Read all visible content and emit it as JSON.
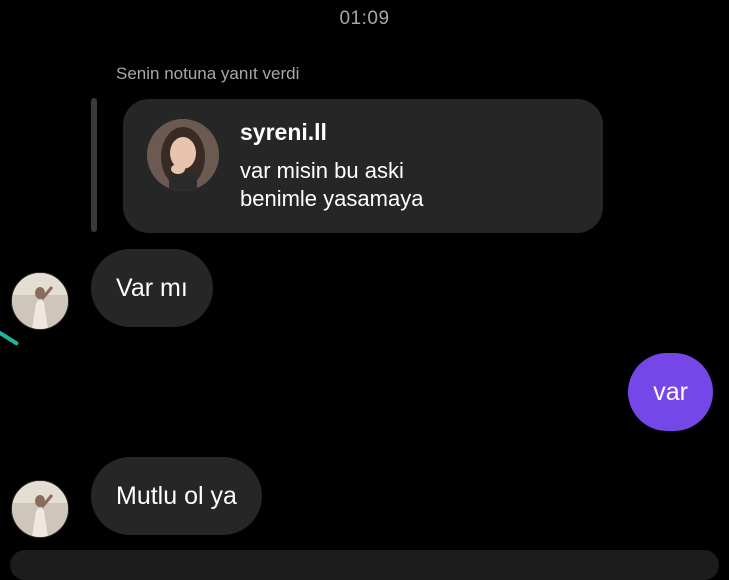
{
  "header": {
    "time": "01:09"
  },
  "reply_context": {
    "label": "Senin notuna yanıt verdi"
  },
  "note": {
    "username": "syreni.ll",
    "text": "var misin bu aski\nbenimle yasamaya",
    "avatar_icon": "profile-photo-icon"
  },
  "messages": [
    {
      "direction": "incoming",
      "text": "Var mı",
      "avatar_icon": "profile-photo-icon"
    },
    {
      "direction": "outgoing",
      "text": "var"
    },
    {
      "direction": "incoming",
      "text": "Mutlu ol ya",
      "avatar_icon": "profile-photo-icon"
    }
  ],
  "colors": {
    "background": "#000000",
    "incoming_bubble": "#262626",
    "outgoing_bubble": "#7547e8",
    "secondary_text": "#a8a8a8"
  }
}
